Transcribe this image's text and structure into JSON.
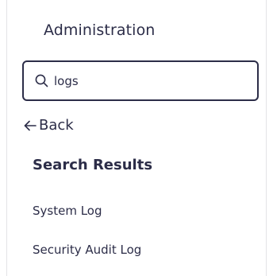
{
  "panel": {
    "title": "Administration"
  },
  "search": {
    "value": "logs",
    "icon": "search-icon"
  },
  "nav": {
    "back_label": "Back",
    "back_icon": "arrow-left-icon"
  },
  "results": {
    "heading": "Search Results",
    "items": [
      {
        "label": "System Log"
      },
      {
        "label": "Security Audit Log"
      }
    ]
  },
  "colors": {
    "text": "#2c2d48",
    "border": "#e3e3e6",
    "input_border": "#2c2d48",
    "background": "#ffffff"
  }
}
